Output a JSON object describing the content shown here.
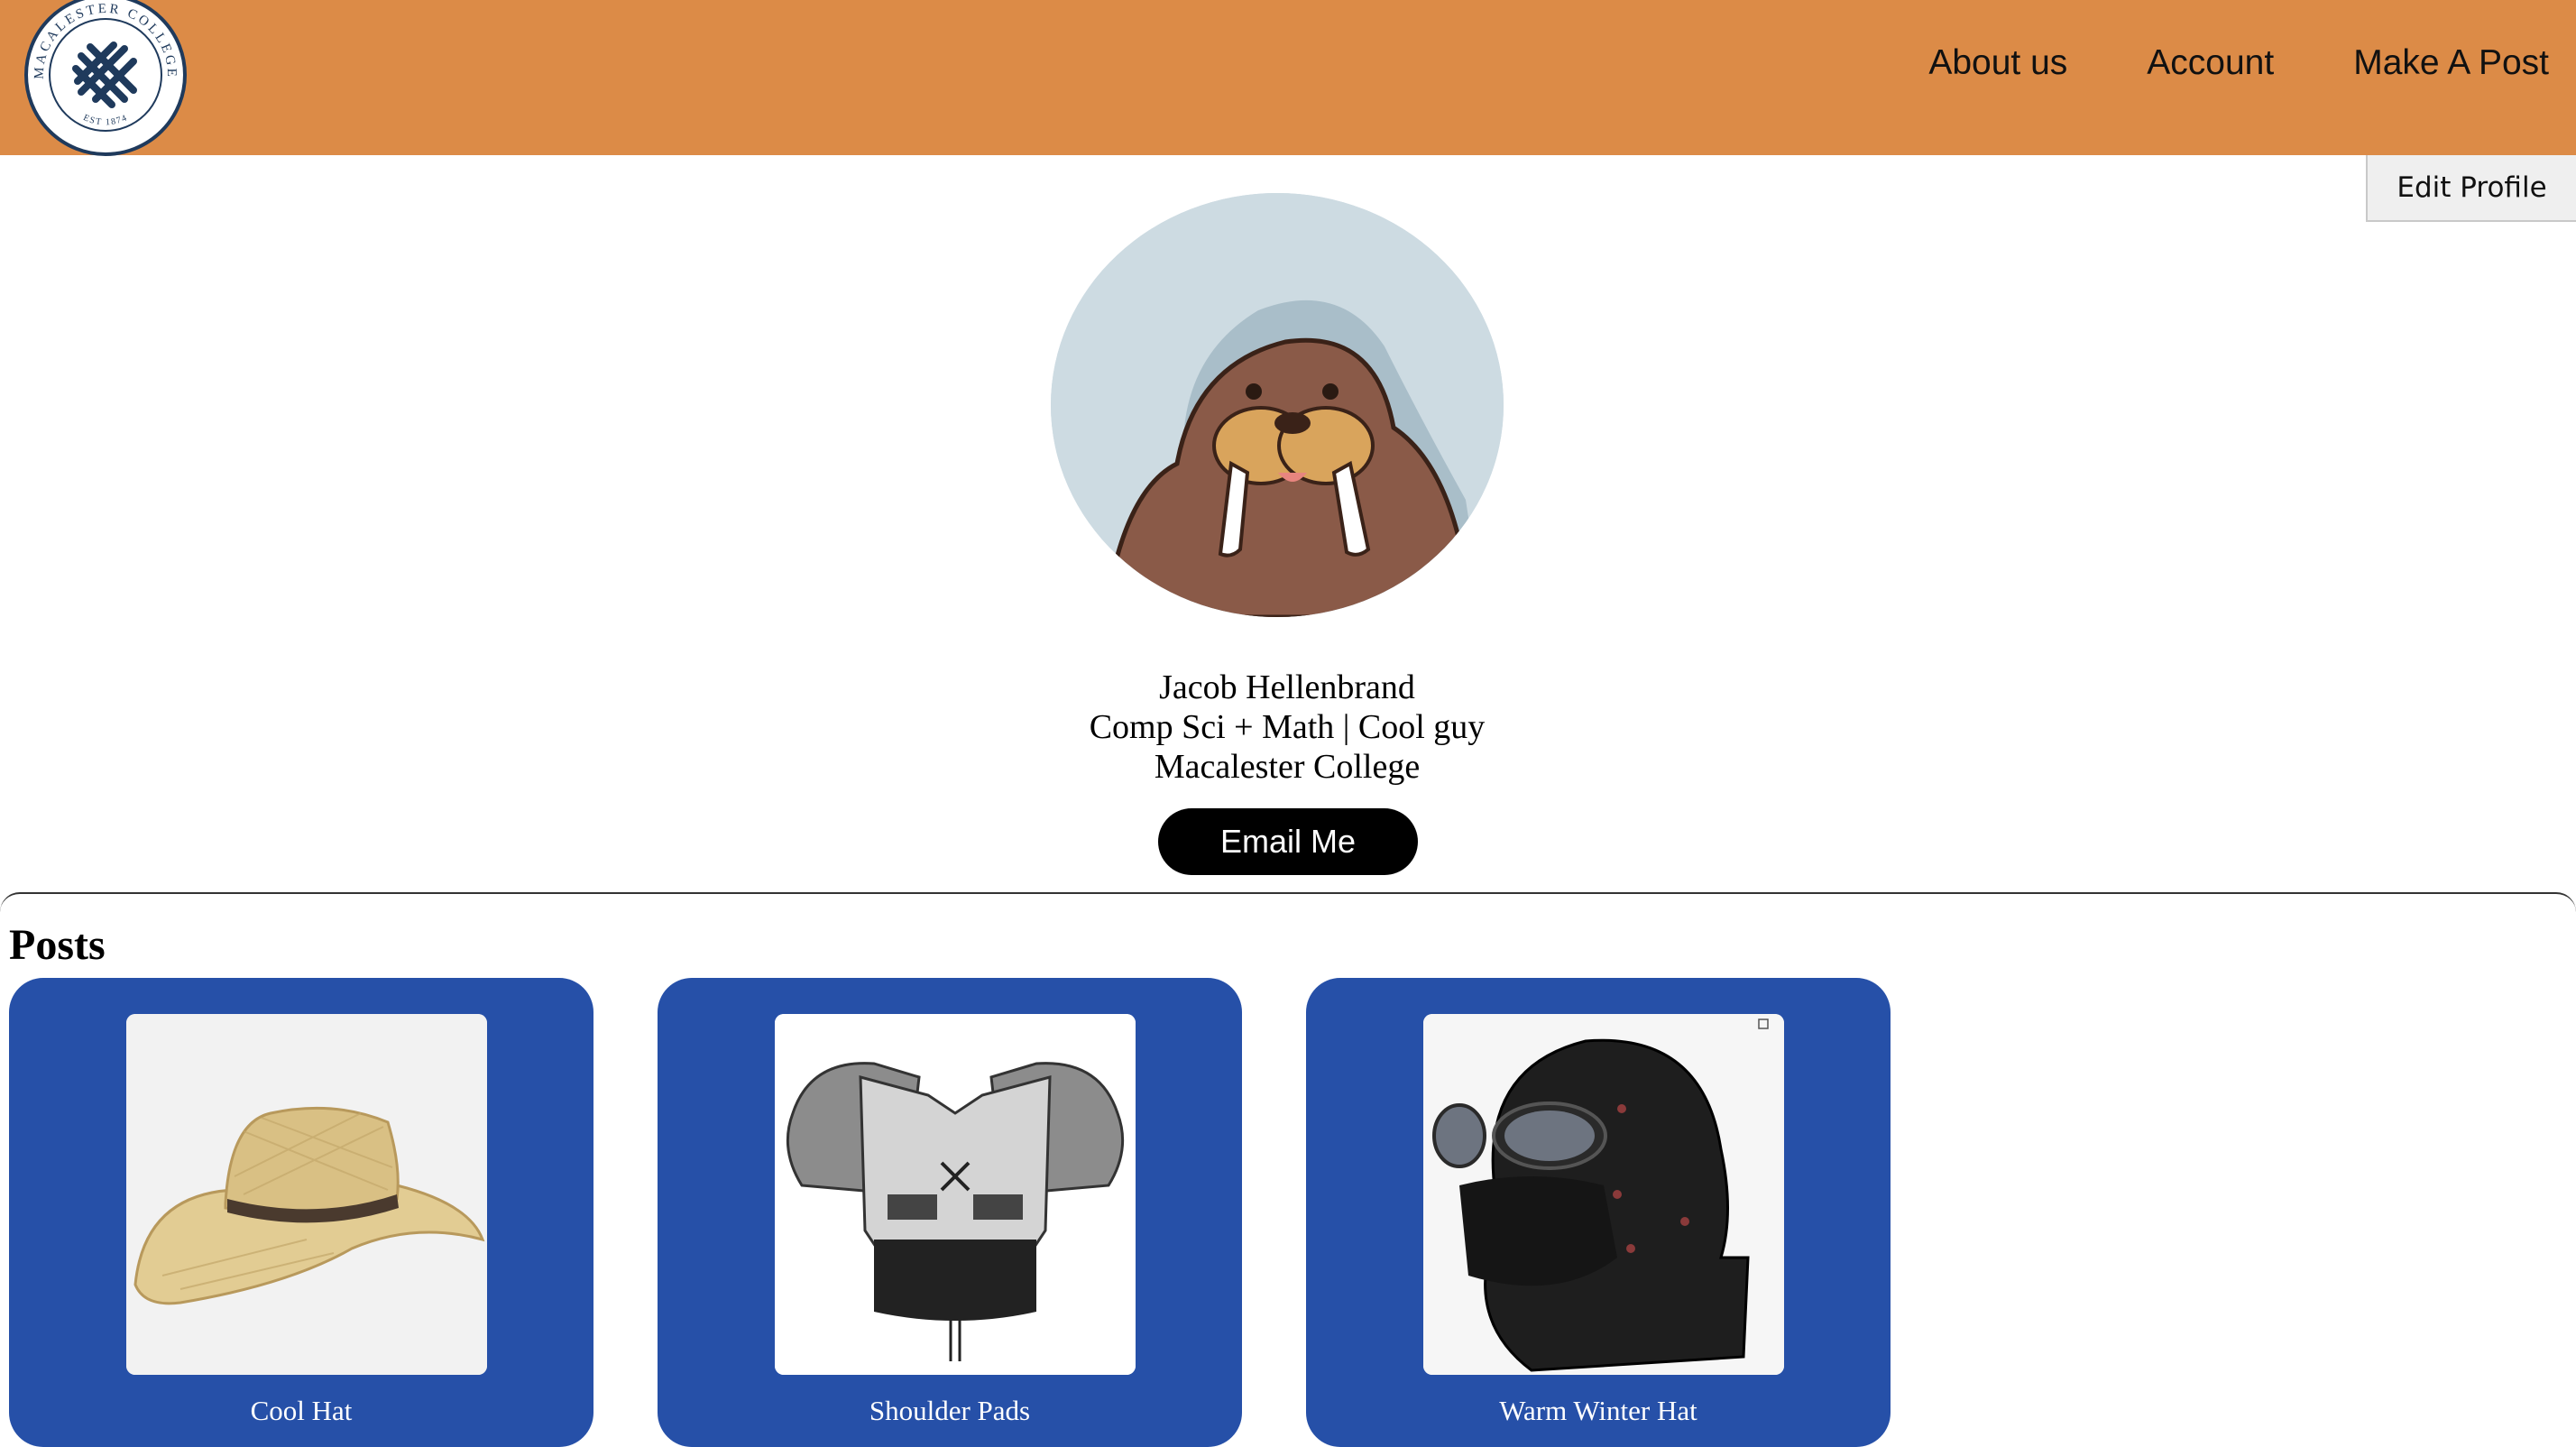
{
  "header": {
    "logo": {
      "name": "MACALESTER COLLEGE",
      "est": "EST 1874"
    },
    "nav": [
      "About us",
      "Account",
      "Make A Post"
    ]
  },
  "profile": {
    "edit_label": "Edit Profile",
    "name": "Jacob Hellenbrand",
    "bio": "Comp Sci + Math | Cool guy",
    "school": "Macalester College",
    "email_label": "Email Me"
  },
  "posts": {
    "heading": "Posts",
    "items": [
      {
        "title": "Cool Hat",
        "icon": "straw-hat-image"
      },
      {
        "title": "Shoulder Pads",
        "icon": "shoulder-pads-image"
      },
      {
        "title": "Warm Winter Hat",
        "icon": "winter-hat-image"
      }
    ]
  },
  "colors": {
    "header": "#dc8b47",
    "card": "#2650a8",
    "button": "#000000"
  }
}
